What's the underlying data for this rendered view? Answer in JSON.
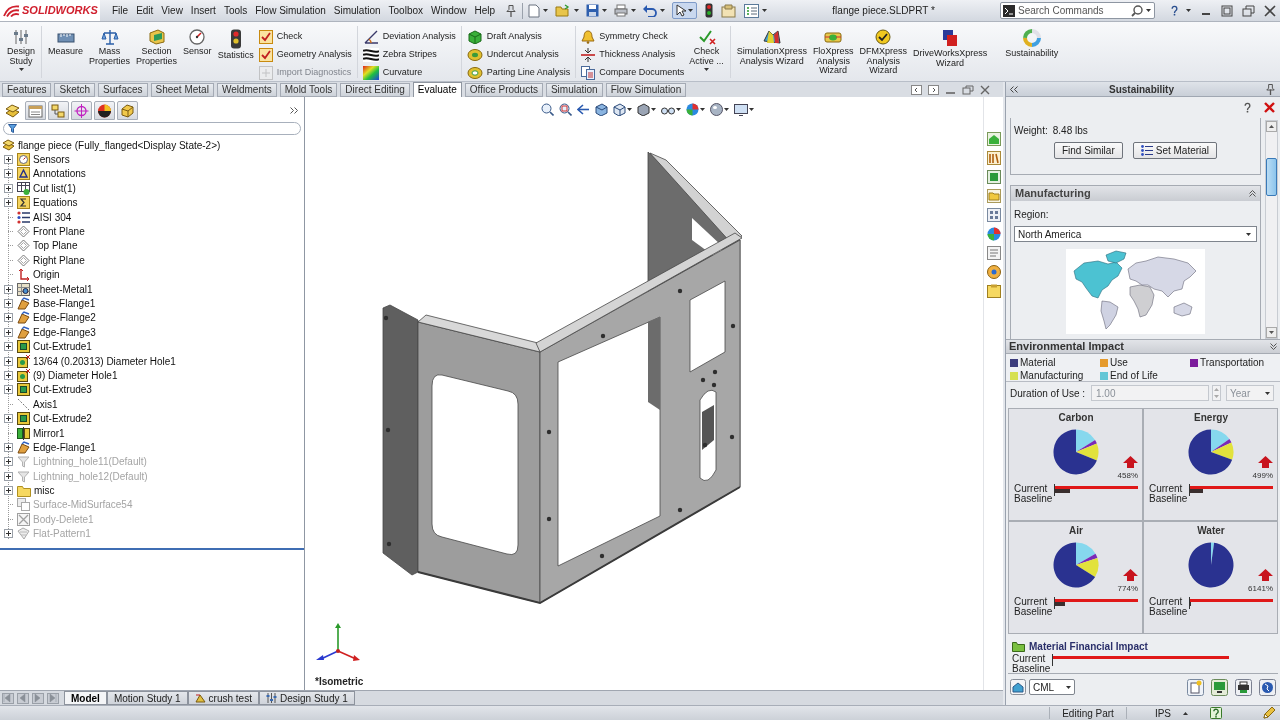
{
  "title_bar": {
    "logo": "SOLIDWORKS",
    "menu": [
      "File",
      "Edit",
      "View",
      "Insert",
      "Tools",
      "Flow Simulation",
      "Simulation",
      "Toolbox",
      "Window",
      "Help"
    ],
    "document_title": "flange piece.SLDPRT *",
    "search": {
      "placeholder": "Search Commands"
    }
  },
  "ribbon": {
    "groups": [
      {
        "kind": "large",
        "items": [
          {
            "label": "Design\nStudy",
            "dropdown": true
          }
        ]
      },
      {
        "kind": "large",
        "items": [
          {
            "label": "Measure",
            "dropdown": false
          },
          {
            "label": "Mass\nProperties",
            "dropdown": false
          },
          {
            "label": "Section\nProperties",
            "dropdown": false
          },
          {
            "label": "Sensor",
            "dropdown": false
          },
          {
            "label": "Statistics",
            "dropdown": false
          }
        ]
      },
      {
        "kind": "small",
        "items": [
          {
            "label": "Check",
            "disabled": false
          },
          {
            "label": "Geometry Analysis",
            "disabled": false
          },
          {
            "label": "Import Diagnostics",
            "disabled": true
          }
        ]
      },
      {
        "kind": "small",
        "items": [
          {
            "label": "Deviation Analysis",
            "disabled": false
          },
          {
            "label": "Zebra Stripes",
            "disabled": false
          },
          {
            "label": "Curvature",
            "disabled": false
          }
        ]
      },
      {
        "kind": "small",
        "items": [
          {
            "label": "Draft Analysis",
            "disabled": false
          },
          {
            "label": "Undercut Analysis",
            "disabled": false
          },
          {
            "label": "Parting Line Analysis",
            "disabled": false
          }
        ]
      },
      {
        "kind": "small",
        "items": [
          {
            "label": "Symmetry Check",
            "disabled": false
          },
          {
            "label": "Thickness Analysis",
            "disabled": false
          },
          {
            "label": "Compare Documents",
            "disabled": false
          }
        ]
      },
      {
        "kind": "large",
        "items": [
          {
            "label": "Check\nActive ...",
            "dropdown": true
          }
        ]
      },
      {
        "kind": "large",
        "items": [
          {
            "label": "SimulationXpress\nAnalysis Wizard",
            "dropdown": false
          },
          {
            "label": "FloXpress\nAnalysis\nWizard",
            "dropdown": false
          },
          {
            "label": "DFMXpress\nAnalysis\nWizard",
            "dropdown": false
          },
          {
            "label": "DriveWorksXpress\nWizard",
            "dropdown": false
          },
          {
            "label": "Sustainability",
            "dropdown": false
          }
        ]
      }
    ]
  },
  "command_tabs": [
    {
      "label": "Features",
      "selected": false
    },
    {
      "label": "Sketch",
      "selected": false
    },
    {
      "label": "Surfaces",
      "selected": false
    },
    {
      "label": "Sheet Metal",
      "selected": false
    },
    {
      "label": "Weldments",
      "selected": false
    },
    {
      "label": "Mold Tools",
      "selected": false
    },
    {
      "label": "Direct Editing",
      "selected": false
    },
    {
      "label": "Evaluate",
      "selected": true
    },
    {
      "label": "Office Products",
      "selected": false
    },
    {
      "label": "Simulation",
      "selected": false
    },
    {
      "label": "Flow Simulation",
      "selected": false
    }
  ],
  "feature_tree": {
    "panel_tabs": [
      {
        "selected": true
      },
      {
        "selected": false
      },
      {
        "selected": false
      },
      {
        "selected": false
      },
      {
        "selected": false
      },
      {
        "selected": false
      }
    ],
    "root": "flange piece (Fully_flanged<Display State-2>)",
    "items": [
      {
        "label": "Sensors",
        "collapsed": true,
        "suppressed": false
      },
      {
        "label": "Annotations",
        "collapsed": true,
        "suppressed": false
      },
      {
        "label": "Cut list(1)",
        "collapsed": true,
        "suppressed": false
      },
      {
        "label": "Equations",
        "collapsed": true,
        "suppressed": false
      },
      {
        "label": "AISI 304",
        "collapsed": false,
        "suppressed": false
      },
      {
        "label": "Front Plane",
        "collapsed": false,
        "suppressed": false
      },
      {
        "label": "Top Plane",
        "collapsed": false,
        "suppressed": false
      },
      {
        "label": "Right Plane",
        "collapsed": false,
        "suppressed": false
      },
      {
        "label": "Origin",
        "collapsed": false,
        "suppressed": false
      },
      {
        "label": "Sheet-Metal1",
        "collapsed": true,
        "suppressed": false
      },
      {
        "label": "Base-Flange1",
        "collapsed": true,
        "suppressed": false
      },
      {
        "label": "Edge-Flange2",
        "collapsed": true,
        "suppressed": false
      },
      {
        "label": "Edge-Flange3",
        "collapsed": true,
        "suppressed": false
      },
      {
        "label": "Cut-Extrude1",
        "collapsed": true,
        "suppressed": false
      },
      {
        "label": "13/64 (0.20313) Diameter Hole1",
        "collapsed": true,
        "suppressed": false
      },
      {
        "label": "(9) Diameter Hole1",
        "collapsed": true,
        "suppressed": false
      },
      {
        "label": "Cut-Extrude3",
        "collapsed": true,
        "suppressed": false
      },
      {
        "label": "Axis1",
        "collapsed": false,
        "suppressed": false
      },
      {
        "label": "Cut-Extrude2",
        "collapsed": true,
        "suppressed": false
      },
      {
        "label": "Mirror1",
        "collapsed": false,
        "suppressed": false
      },
      {
        "label": "Edge-Flange1",
        "collapsed": true,
        "suppressed": false
      },
      {
        "label": "Lightning_hole11(Default)",
        "collapsed": true,
        "suppressed": true
      },
      {
        "label": "Lightning_hole12(Default)",
        "collapsed": true,
        "suppressed": true
      },
      {
        "label": "misc",
        "collapsed": true,
        "suppressed": false
      },
      {
        "label": "Surface-MidSurface54",
        "collapsed": false,
        "suppressed": true
      },
      {
        "label": "Body-Delete1",
        "collapsed": false,
        "suppressed": true
      },
      {
        "label": "Flat-Pattern1",
        "collapsed": true,
        "suppressed": true
      }
    ]
  },
  "viewport": {
    "view_label": "*Isometric"
  },
  "bottom_tabs": [
    {
      "label": "Model",
      "selected": true
    },
    {
      "label": "Motion Study 1",
      "selected": false
    },
    {
      "label": "crush test",
      "selected": false
    },
    {
      "label": "Design Study 1",
      "selected": false
    }
  ],
  "task_pane": {
    "title": "Sustainability",
    "weight_label": "Weight:",
    "weight_value": "8.48 lbs",
    "buttons": [
      "Find Similar",
      "Set Material"
    ],
    "manufacturing": {
      "title": "Manufacturing",
      "region_label": "Region:",
      "region": "North America"
    },
    "environmental_impact": {
      "title": "Environmental Impact",
      "legend": [
        {
          "label": "Material",
          "color": "#3c3c7c"
        },
        {
          "label": "Use",
          "color": "#e59a2c"
        },
        {
          "label": "Transportation",
          "color": "#7c1c9c"
        },
        {
          "label": "Manufacturing",
          "color": "#d6e050"
        },
        {
          "label": "End of Life",
          "color": "#62c6d6"
        }
      ],
      "duration": {
        "label": "Duration of Use :",
        "value": "1.00",
        "unit": "Year",
        "disabled": true
      },
      "metrics": [
        {
          "name": "Carbon",
          "change": "458%",
          "current_label": "Current",
          "baseline_label": "Baseline",
          "level": 0.18
        },
        {
          "name": "Energy",
          "change": "499%",
          "current_label": "Current",
          "baseline_label": "Baseline",
          "level": 0.16
        },
        {
          "name": "Air",
          "change": "774%",
          "current_label": "Current",
          "baseline_label": "Baseline",
          "level": 0.12
        },
        {
          "name": "Water",
          "change": "6141%",
          "current_label": "Current",
          "baseline_label": "Baseline",
          "level": 0.01
        }
      ]
    },
    "financial_impact": {
      "title": "Material Financial Impact",
      "current_label": "Current",
      "baseline_label": "Baseline"
    },
    "units": "CML"
  },
  "status_bar": {
    "mode": "Editing Part",
    "units": "IPS"
  }
}
